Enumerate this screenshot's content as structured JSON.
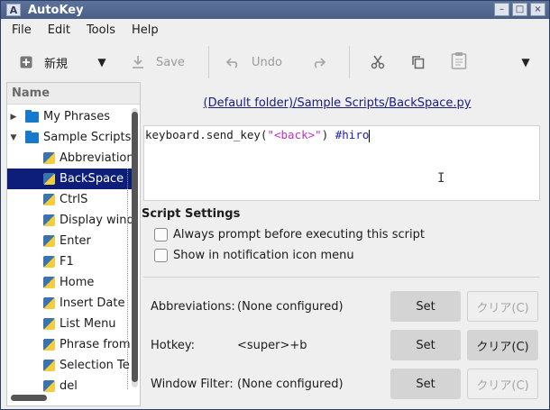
{
  "window": {
    "title": "AutoKey",
    "app_icon": "A"
  },
  "window_buttons": {
    "minimize": "–",
    "maximize": "□",
    "close": "×"
  },
  "menu": [
    "File",
    "Edit",
    "Tools",
    "Help"
  ],
  "toolbar": {
    "new_label": "新規",
    "save_label": "Save",
    "undo_label": "Undo"
  },
  "tree": {
    "header": "Name",
    "folders": [
      "My Phrases",
      "Sample Scripts"
    ],
    "items": [
      "Abbreviation",
      "BackSpace",
      "CtrlS",
      "Display wind",
      "Enter",
      "F1",
      "Home",
      "Insert Date",
      "List Menu",
      "Phrase from",
      "Selection Te",
      "del"
    ]
  },
  "editor": {
    "path": "(Default folder)/Sample Scripts/BackSpace.py",
    "code_prefix": "keyboard.send_key(",
    "code_string": "\"<back>\"",
    "code_suffix": ") ",
    "code_comment": "#hiro"
  },
  "settings": {
    "title": "Script Settings",
    "always_prompt": "Always prompt before executing this script",
    "show_in_notification": "Show in notification icon menu",
    "abbreviations_label": "Abbreviations:",
    "abbreviations_value": "(None configured)",
    "hotkey_label": "Hotkey:",
    "hotkey_value": "<super>+b",
    "window_filter_label": "Window Filter:",
    "window_filter_value": "(None configured)",
    "set_label": "Set",
    "clear_label": "クリア(C)"
  },
  "colors": {
    "titlebar": "#4f648c",
    "selection": "#0c1e7a",
    "link": "#1a1d7a",
    "string": "#c030c0",
    "comment": "#2020b0"
  }
}
